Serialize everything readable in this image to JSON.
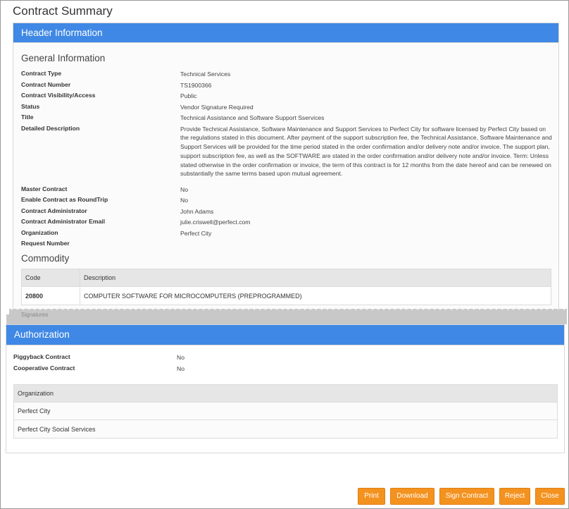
{
  "page": {
    "title": "Contract Summary"
  },
  "header_panel": {
    "title": "Header Information",
    "general_title": "General Information",
    "fields": [
      {
        "label": "Contract Type",
        "value": "Technical Services"
      },
      {
        "label": "Contract Number",
        "value": "TS1900366"
      },
      {
        "label": "Contract Visibility/Access",
        "value": "Public"
      },
      {
        "label": "Status",
        "value": "Vendor Signature Required"
      },
      {
        "label": "Title",
        "value": "Technical Assistance and Software Support Sservices"
      },
      {
        "label": "Detailed Description",
        "value": "Provide Technical Assistance, Software Maintenance and Support Services to Perfect City for software licensed by Perfect City based on the regulations stated in this document. After payment of the support subscription fee, the Technical Assistance, Software Maintenance and Support Services will be provided for the time period stated in the order confirmation and/or delivery note and/or invoice. The support plan, support subscription fee, as well as the SOFTWARE are stated in the order confirmation and/or delivery note and/or invoice. Term: Unless stated otherwise in the order confirmation or invoice, the term of this contract is for 12 months from the date hereof and can be renewed on substantially the same terms based upon mutual agreement."
      },
      {
        "label": "Master Contract",
        "value": "No"
      },
      {
        "label": "Enable Contract as RoundTrip",
        "value": "No"
      },
      {
        "label": "Contract Administrator",
        "value": "John Adams"
      },
      {
        "label": "Contract Administrator Email",
        "value": "julie.criswell@perfect.com"
      },
      {
        "label": "Organization",
        "value": "Perfect City"
      },
      {
        "label": "Request Number",
        "value": ""
      }
    ],
    "commodity": {
      "title": "Commodity",
      "columns": [
        "Code",
        "Description"
      ],
      "rows": [
        {
          "code": "20800",
          "description": "COMPUTER SOFTWARE FOR MICROCOMPUTERS (PREPROGRAMMED)"
        }
      ]
    },
    "cut_off_text": "Signatures"
  },
  "authorization_panel": {
    "title": "Authorization",
    "fields": [
      {
        "label": "Piggyback Contract",
        "value": "No"
      },
      {
        "label": "Cooperative Contract",
        "value": "No"
      }
    ],
    "org_table": {
      "columns": [
        "Organization"
      ],
      "rows": [
        "Perfect City",
        "Perfect City Social Services"
      ]
    }
  },
  "buttons": {
    "print": "Print",
    "download": "Download",
    "sign_contract": "Sign Contract",
    "reject": "Reject",
    "close": "Close"
  },
  "colors": {
    "panel_header": "#3f88e5",
    "button": "#f4921f"
  }
}
